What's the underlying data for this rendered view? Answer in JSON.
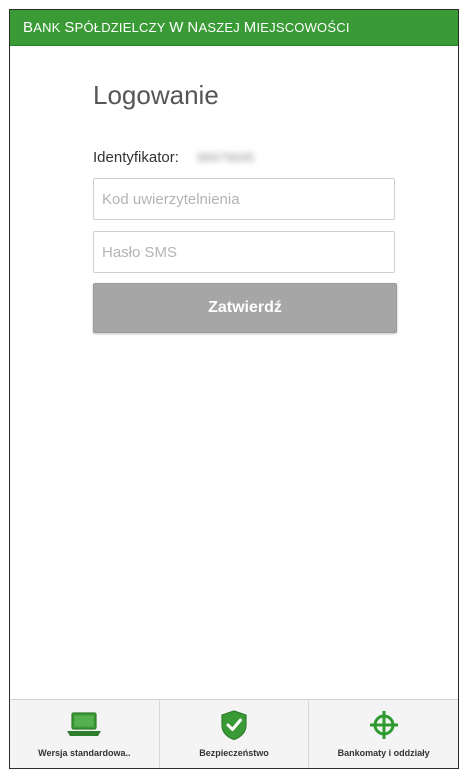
{
  "header": {
    "title": "Bank Spółdzielczy w Naszej Miejscowości"
  },
  "login": {
    "title": "Logowanie",
    "identifier_label": "Identyfikator:",
    "identifier_value": "98979695",
    "auth_code_placeholder": "Kod uwierzytelnienia",
    "sms_password_placeholder": "Hasło SMS",
    "submit_label": "Zatwierdź"
  },
  "bottom_nav": {
    "items": [
      {
        "label": "Wersja standardowa..",
        "icon": "laptop-icon"
      },
      {
        "label": "Bezpieczeństwo",
        "icon": "shield-check-icon"
      },
      {
        "label": "Bankomaty i oddziały",
        "icon": "crosshair-icon"
      }
    ]
  },
  "colors": {
    "brand_green": "#3a9a36",
    "button_disabled": "#a6a6a6"
  }
}
